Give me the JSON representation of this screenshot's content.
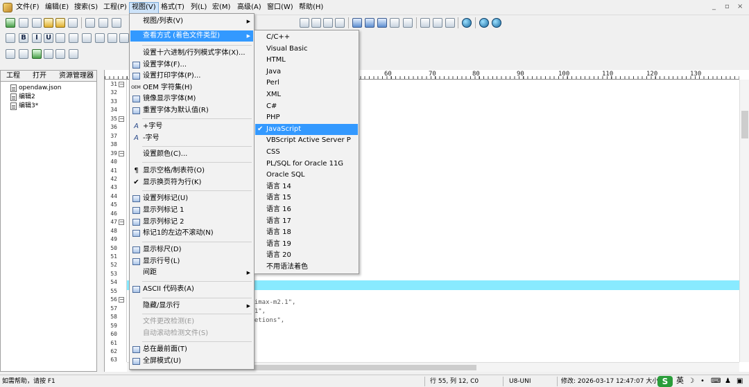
{
  "menubar": {
    "items": [
      "文件(F)",
      "编辑(E)",
      "搜索(S)",
      "工程(P)",
      "视图(V)",
      "格式(T)",
      "列(L)",
      "宏(M)",
      "高级(A)",
      "窗口(W)",
      "帮助(H)"
    ],
    "window_controls": [
      "_",
      "▫",
      "×"
    ]
  },
  "toolbar": {
    "encoding_value": "a",
    "encoding_arrow": "▼"
  },
  "left_panel": {
    "tabs": [
      "工程",
      "打开",
      "资源管理器"
    ],
    "files": [
      "opendaw.json",
      "编辑2",
      "编辑3*"
    ]
  },
  "editor": {
    "ruler_numbers": [
      "60",
      "70",
      "80",
      "90",
      "100",
      "110",
      "120",
      "130"
    ],
    "line_numbers": [
      "31",
      "32",
      "33",
      "34",
      "35",
      "36",
      "37",
      "38",
      "39",
      "40",
      "41",
      "42",
      "43",
      "44",
      "45",
      "46",
      "47",
      "48",
      "49",
      "50",
      "51",
      "52",
      "53",
      "54",
      "55",
      "56",
      "57",
      "58",
      "59",
      "60",
      "61",
      "62",
      "63"
    ],
    "fold_lines": [
      "31",
      "35",
      "39",
      "47",
      "56"
    ],
    "code_fragments": [
      "inimax-m2.1\",",
      "2.1\",",
      "pletions\",",
      "\","
    ],
    "highlight_color": "#88eaff"
  },
  "view_menu": {
    "items": [
      {
        "label": "视图/列表(V)",
        "icon": "",
        "submenu": true
      },
      {
        "label": "查看方式 (着色文件类型)",
        "icon": "",
        "submenu": true,
        "highlighted": true
      },
      {
        "label": "设置十六进制/行列模式字体(X)...",
        "icon": ""
      },
      {
        "label": "设置字体(F)...",
        "icon": "font-icon"
      },
      {
        "label": "设置打印字体(P)...",
        "icon": "print-font-icon"
      },
      {
        "label": "OEM 字符集(H)",
        "icon": "oem-icon",
        "icon_text": "OEM"
      },
      {
        "label": "镜像显示字体(M)",
        "icon": "mirror-font-icon"
      },
      {
        "label": "重置字体为默认值(R)",
        "icon": "reset-font-icon"
      },
      {
        "label": "+字号",
        "icon": "font-increase-icon",
        "icon_text": "A"
      },
      {
        "label": "-字号",
        "icon": "font-decrease-icon",
        "icon_text": "A"
      },
      {
        "label": "设置颜色(C)...",
        "icon": ""
      },
      {
        "label": "显示空格/制表符(O)",
        "icon": "pilcrow-icon",
        "icon_text": "¶"
      },
      {
        "label": "显示换页符为行(K)",
        "icon": "checkmark-icon",
        "icon_text": "✔"
      },
      {
        "label": "设置列标记(U)",
        "icon": "column-marker-icon"
      },
      {
        "label": "显示列标记 1",
        "icon": "column-marker-1-icon"
      },
      {
        "label": "显示列标记 2",
        "icon": "column-marker-2-icon"
      },
      {
        "label": "标记1的左边不滚动(N)",
        "icon": "no-scroll-icon"
      },
      {
        "label": "显示标尺(D)",
        "icon": "ruler-icon"
      },
      {
        "label": "显示行号(L)",
        "icon": "line-number-icon"
      },
      {
        "label": "间距",
        "icon": "",
        "submenu": true
      },
      {
        "label": "ASCII 代码表(A)",
        "icon": "ascii-table-icon"
      },
      {
        "label": "隐藏/显示行",
        "icon": "",
        "submenu": true
      },
      {
        "label": "文件更改检测(E)",
        "icon": "",
        "disabled": true
      },
      {
        "label": "自动滚动检测文件(S)",
        "icon": "",
        "disabled": true
      },
      {
        "label": "总在最前面(T)",
        "icon": "always-on-top-icon"
      },
      {
        "label": "全屏模式(U)",
        "icon": "fullscreen-icon"
      }
    ],
    "submenu_arrow": "▶"
  },
  "syntax_submenu": {
    "items": [
      "C/C++",
      "Visual Basic",
      "HTML",
      "Java",
      "Perl",
      "XML",
      "C#",
      "PHP",
      "JavaScript",
      "VBScript Active Server P",
      "CSS",
      "PL/SQL for Oracle 11G",
      "Oracle SQL",
      "语言 14",
      "语言 15",
      "语言 16",
      "语言 17",
      "语言 18",
      "语言 19",
      "语言 20",
      "不用语法着色"
    ],
    "selected": "JavaScript",
    "check": "✔"
  },
  "statusbar": {
    "help": "如需帮助，请按 F1",
    "position": "行 55, 列 12, C0",
    "encoding": "U8-UNI",
    "modified": "修改: 2026-03-17 12:47:07 大小",
    "ime_logo": "S",
    "ime_lang": "英",
    "ime_icons": [
      "☽",
      "•",
      "⌨",
      "♟",
      "▣"
    ],
    "colors": {
      "selection": "#3399ff",
      "ime": "#2a9d3a"
    }
  }
}
